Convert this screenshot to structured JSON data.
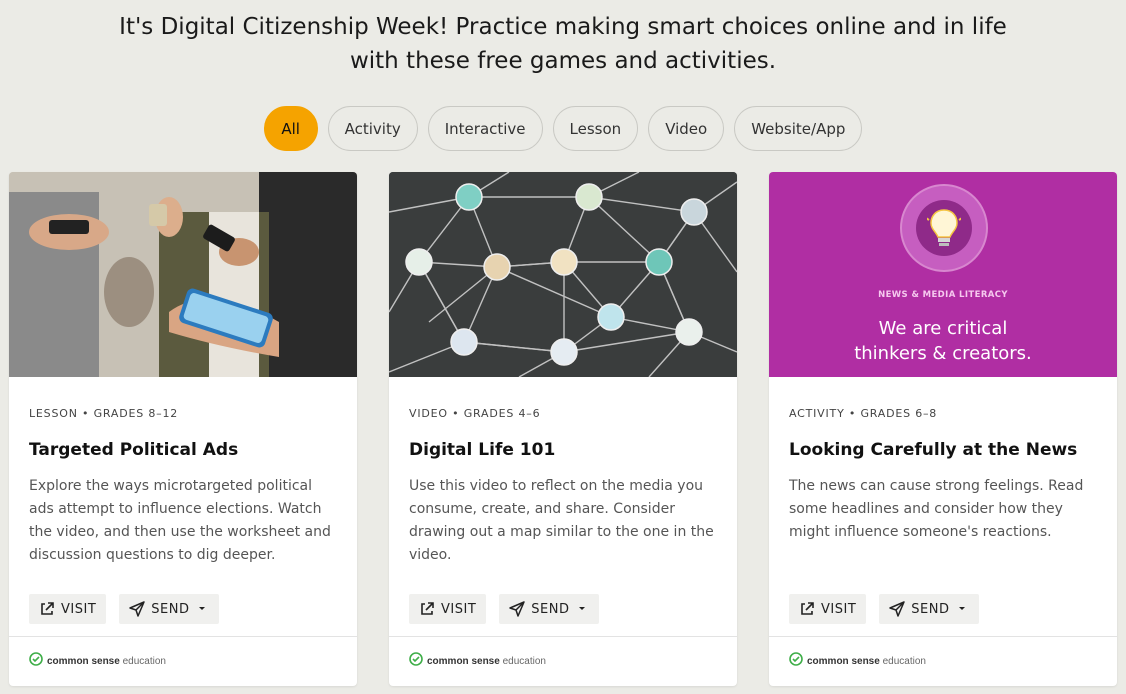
{
  "headline": "It's Digital Citizenship Week! Practice making smart choices online and in life with these free games and activities.",
  "filters": [
    "All",
    "Activity",
    "Interactive",
    "Lesson",
    "Video",
    "Website/App"
  ],
  "active_filter": "All",
  "accent_color": "#f5a300",
  "cards": [
    {
      "meta": "LESSON • GRADES 8–12",
      "title": "Targeted Political Ads",
      "description": "Explore the ways microtargeted political ads attempt to influence elections. Watch the video, and then use the worksheet and discussion questions to dig deeper.",
      "visit_label": "VISIT",
      "send_label": "SEND",
      "brand_bold": "common sense",
      "brand_light": " education"
    },
    {
      "meta": "VIDEO • GRADES 4–6",
      "title": "Digital Life 101",
      "description": "Use this video to reflect on the media you consume, create, and share. Consider drawing out a map similar to the one in the video.",
      "visit_label": "VISIT",
      "send_label": "SEND",
      "brand_bold": "common sense",
      "brand_light": " education"
    },
    {
      "meta": "ACTIVITY • GRADES 6–8",
      "title": "Looking Carefully at the News",
      "description": "The news can cause strong feelings. Read some headlines and consider how they might influence someone's reactions.",
      "visit_label": "VISIT",
      "send_label": "SEND",
      "brand_bold": "common sense",
      "brand_light": " education",
      "image_tag": "NEWS & MEDIA LITERACY",
      "image_tagline": "We are critical thinkers & creators."
    }
  ]
}
